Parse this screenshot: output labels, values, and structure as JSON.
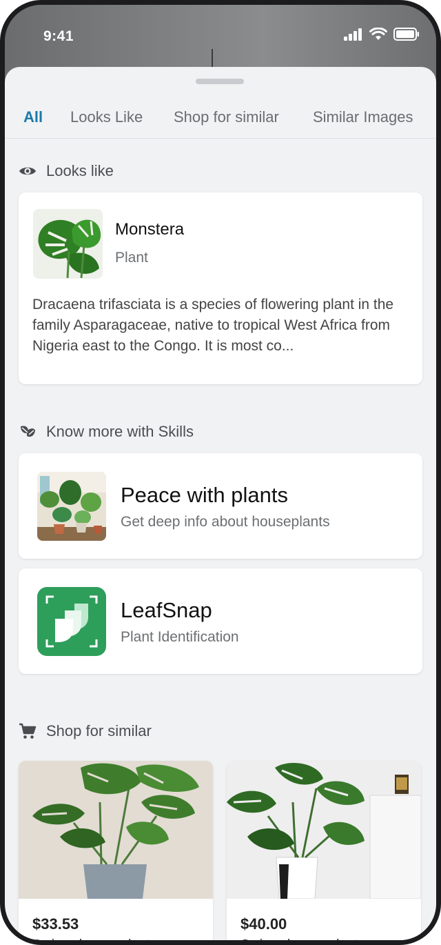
{
  "status": {
    "time": "9:41"
  },
  "tabs": [
    {
      "label": "All"
    },
    {
      "label": "Looks Like"
    },
    {
      "label": "Shop for similar"
    },
    {
      "label": "Similar Images"
    }
  ],
  "looks_like": {
    "heading": "Looks like",
    "name": "Monstera",
    "category": "Plant",
    "description": "Dracaena trifasciata is a species of flowering plant in the family Asparagaceae, native to tropical West Africa from Nigeria east to the Congo. It is most co..."
  },
  "skills": {
    "heading": "Know more with Skills",
    "items": [
      {
        "title": "Peace with plants",
        "subtitle": "Get deep info about houseplants"
      },
      {
        "title": "LeafSnap",
        "subtitle": "Plant Identification"
      }
    ]
  },
  "shop": {
    "heading": "Shop for similar",
    "products": [
      {
        "price": "$33.53",
        "name": "Swiss cheese plant"
      },
      {
        "price": "$40.00",
        "name": "Swiss cheese plant"
      }
    ]
  },
  "colors": {
    "accent": "#1a7aa8",
    "leafsnap_green": "#2e9e5b"
  }
}
